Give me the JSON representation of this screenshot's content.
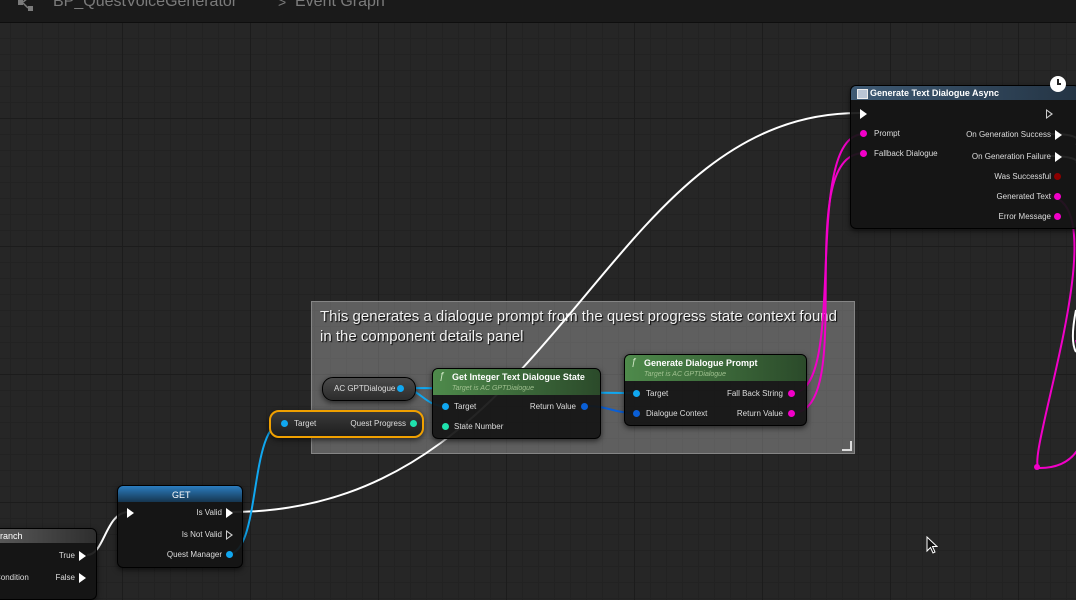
{
  "breadcrumb": {
    "blueprint": "BP_QuestVoiceGenerator",
    "separator": ">",
    "graph": "Event Graph"
  },
  "comment": {
    "text": "This generates a dialogue prompt from the quest progress state context found in the component details panel"
  },
  "nodes": {
    "generate_async": {
      "title": "Generate Text Dialogue Async",
      "inputs": [
        "Prompt",
        "Fallback Dialogue"
      ],
      "outputs": [
        "On Generation Success",
        "On Generation Failure",
        "Was Successful",
        "Generated Text",
        "Error Message"
      ]
    },
    "ac_gpt": {
      "label": "AC GPTDialogue"
    },
    "get_integer": {
      "title": "Get Integer Text Dialogue State",
      "subtitle": "Target is AC GPTDialogue",
      "inputs": [
        "Target",
        "State Number"
      ],
      "outputs": [
        "Return Value"
      ]
    },
    "generate_prompt": {
      "title": "Generate Dialogue Prompt",
      "subtitle": "Target is AC GPTDialogue",
      "inputs": [
        "Target",
        "Dialogue Context"
      ],
      "outputs": [
        "Fall Back String",
        "Return Value"
      ]
    },
    "quest_progress": {
      "input": "Target",
      "output": "Quest Progress"
    },
    "get": {
      "title": "GET",
      "outputs": [
        "Is Valid",
        "Is Not Valid",
        "Quest Manager"
      ]
    },
    "branch": {
      "title": "Branch",
      "inputs": [
        "Condition"
      ],
      "outputs": [
        "True",
        "False"
      ]
    }
  },
  "colors": {
    "exec": "#ffffff",
    "object_pin": "#10a7f0",
    "string_pin": "#f200c8",
    "int_pin": "#1fe2ad",
    "bool_pin": "#8c0000",
    "struct_pin": "#0a5fd6",
    "func_header": "#3d6e3b",
    "async_header": "#34485c",
    "get_header": "#1a4f78",
    "selected_outline": "#f0a000"
  },
  "icons": {
    "graph": "blueprint-graph-icon",
    "clock": "latent-clock-icon",
    "cursor": "mouse-cursor-icon"
  }
}
